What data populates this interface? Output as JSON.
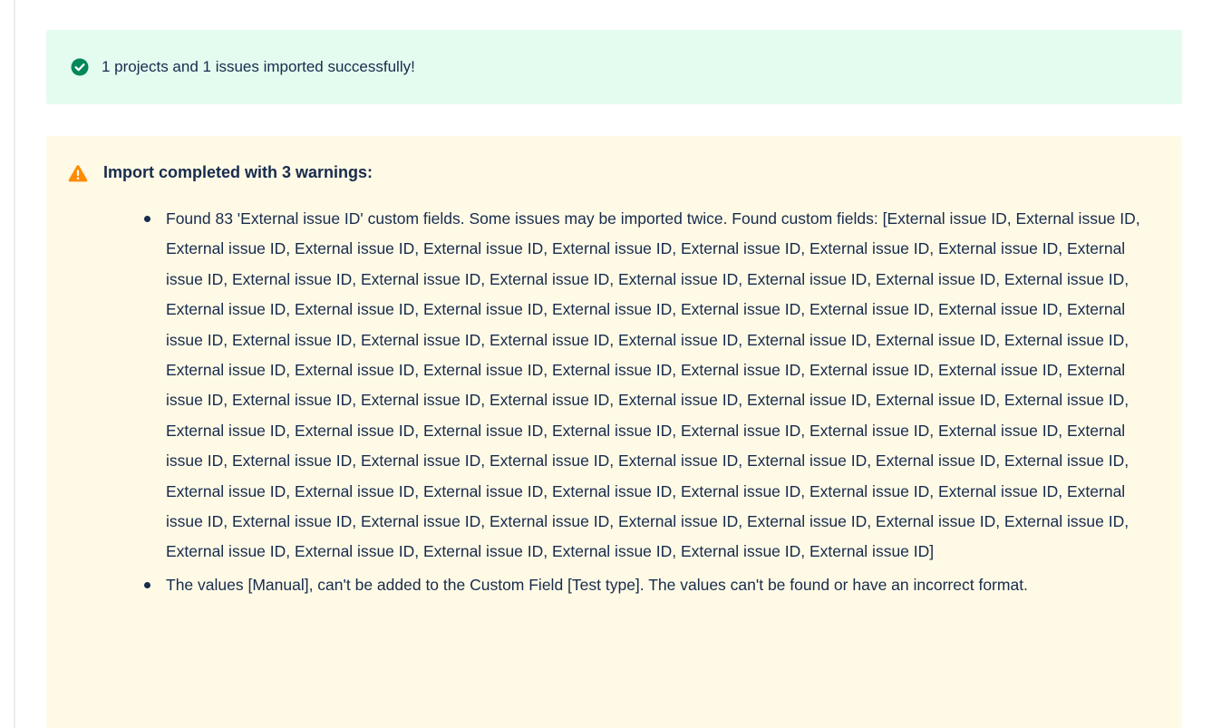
{
  "success": {
    "icon": "check-circle-icon",
    "color": "#00875a",
    "background": "#e3fcef",
    "message": "1 projects and 1 issues imported successfully!"
  },
  "warning": {
    "icon": "warning-triangle-icon",
    "color": "#ff8b00",
    "background": "#fffae6",
    "title": "Import completed with 3 warnings:",
    "items": [
      {
        "text": "Found 83 'External issue ID' custom fields. Some issues may be imported twice. Found custom fields: [External issue ID, External issue ID, External issue ID, External issue ID, External issue ID, External issue ID, External issue ID, External issue ID, External issue ID, External issue ID, External issue ID, External issue ID, External issue ID, External issue ID, External issue ID, External issue ID, External issue ID, External issue ID, External issue ID, External issue ID, External issue ID, External issue ID, External issue ID, External issue ID, External issue ID, External issue ID, External issue ID, External issue ID, External issue ID, External issue ID, External issue ID, External issue ID, External issue ID, External issue ID, External issue ID, External issue ID, External issue ID, External issue ID, External issue ID, External issue ID, External issue ID, External issue ID, External issue ID, External issue ID, External issue ID, External issue ID, External issue ID, External issue ID, External issue ID, External issue ID, External issue ID, External issue ID, External issue ID, External issue ID, External issue ID, External issue ID, External issue ID, External issue ID, External issue ID, External issue ID, External issue ID, External issue ID, External issue ID, External issue ID, External issue ID, External issue ID, External issue ID, External issue ID, External issue ID, External issue ID, External issue ID, External issue ID, External issue ID, External issue ID, External issue ID, External issue ID, External issue ID, External issue ID, External issue ID, External issue ID, External issue ID, External issue ID, External issue ID]"
      },
      {
        "text": "The values [Manual], can't be added to the Custom Field [Test type]. The values can't be found or have an incorrect format."
      }
    ]
  }
}
